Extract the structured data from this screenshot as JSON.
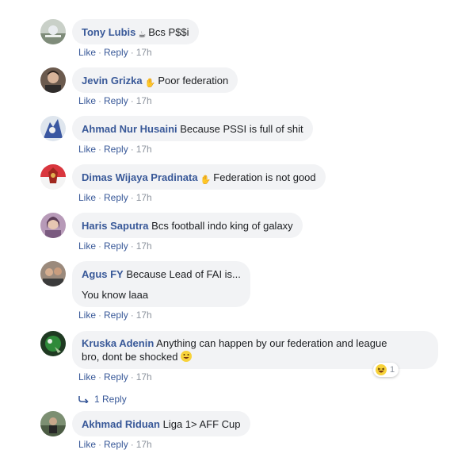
{
  "actions": {
    "like": "Like",
    "reply": "Reply",
    "sep": "·"
  },
  "comments": [
    {
      "author": "Tony Lubis",
      "emoji": "☕",
      "text": "Bcs P$$i",
      "time": "17h"
    },
    {
      "author": "Jevin Grizka",
      "emoji": "✋",
      "text": "Poor federation",
      "time": "17h"
    },
    {
      "author": "Ahmad Nur Husaini",
      "emoji": "",
      "text": "Because PSSI is full of shit",
      "time": "17h"
    },
    {
      "author": "Dimas Wijaya Pradinata",
      "emoji": "✋",
      "text": "Federation is not good",
      "time": "17h"
    },
    {
      "author": "Haris Saputra",
      "emoji": "",
      "text": "Bcs football indo king of galaxy",
      "time": "17h"
    },
    {
      "author": "Agus FY",
      "emoji": "",
      "text": "Because Lead of FAI is...",
      "text2": "You know laaa",
      "time": "17h"
    },
    {
      "author": "Kruska Adenin",
      "emoji": "",
      "text": "Anything can happen by our federation and league",
      "text2": "bro, dont be shocked",
      "time": "17h",
      "reaction_count": "1",
      "reply_count": "1 Reply"
    },
    {
      "author": "Akhmad Riduan",
      "emoji": "",
      "text": "Liga 1> AFF Cup",
      "time": "17h"
    }
  ],
  "colors": {
    "author": "#385898",
    "bubble": "#f2f3f5",
    "meta": "#8d949e"
  },
  "icons": {
    "reaction": "laughing-emoji-icon",
    "reply_arrow": "reply-arrow-icon"
  }
}
